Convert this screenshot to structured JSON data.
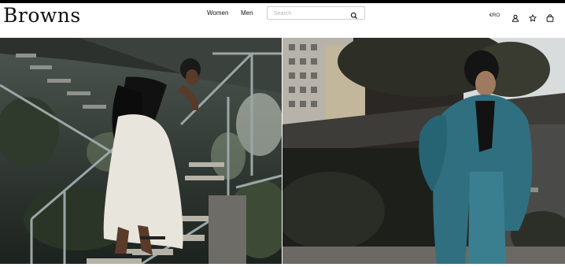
{
  "header": {
    "logo": "Browns",
    "nav": [
      "Women",
      "Men"
    ],
    "search": {
      "placeholder": "Search",
      "value": ""
    },
    "currency": "€RO"
  },
  "icons": {
    "search": "search-icon",
    "account": "user-icon",
    "wishlist": "star-icon",
    "bag": "shopping-bag-icon"
  },
  "hero": {
    "left": {
      "subject": "woman-staircase-photo"
    },
    "right": {
      "subject": "man-teal-suit-photo"
    }
  }
}
